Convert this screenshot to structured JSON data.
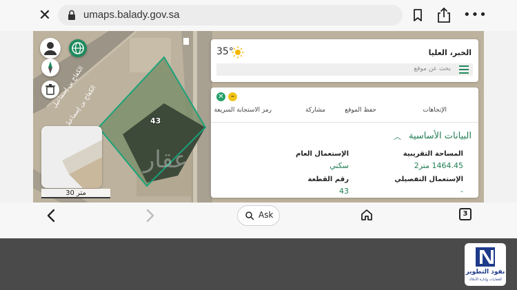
{
  "browser": {
    "url": "umaps.balady.gov.sa",
    "ask_label": "Ask",
    "tab_count": "3"
  },
  "map": {
    "scale_label": "30 متر",
    "parcel_number": "43",
    "street_label_1": "الكفاح بن إسماعيل",
    "street_label_2": "الكفاح بن إسماعيل",
    "watermark": "عقار"
  },
  "weather": {
    "temperature": "35°"
  },
  "location": {
    "place_name": "الخبر، العليا",
    "search_placeholder": "بحث عن موقع"
  },
  "actions": [
    "الإتجاهات",
    "حفظ الموقع",
    "مشاركة",
    "رمز الاستجابة السريعة"
  ],
  "details": {
    "section_title": "البيانات الأساسية",
    "area_label": "المساحة التقريبية",
    "area_value": "1464.45 متر2",
    "public_use_label": "الإستعمال العام",
    "public_use_value": "سكني",
    "detailed_use_label": "الإستعمال التفصيلي",
    "detailed_use_value": "-",
    "plot_label": "رقم القطعة",
    "plot_value": "43"
  },
  "footer": {
    "brand_name": "نفوذ التطوير",
    "brand_sub": "للعقارات وإدارة الأملاك"
  }
}
